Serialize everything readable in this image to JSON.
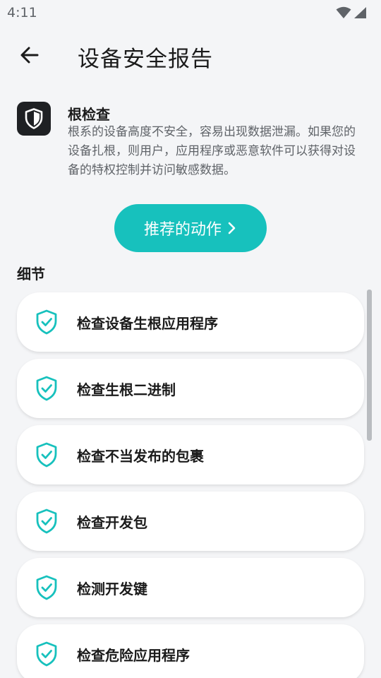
{
  "status_bar": {
    "time": "4:11",
    "icons": [
      "wifi-icon",
      "signal-icon"
    ]
  },
  "toolbar": {
    "back_icon": "arrow-left-icon",
    "title": "设备安全报告"
  },
  "root_check": {
    "icon": "shield-icon",
    "title": "根检查",
    "description": "根系的设备高度不安全，容易出现数据泄漏。如果您的设备扎根，则用户，应用程序或恶意软件可以获得对设备的特权控制并访问敏感数据。"
  },
  "action_button": {
    "label": "推荐的动作",
    "icon": "chevron-right-icon"
  },
  "details": {
    "label": "细节",
    "items": [
      {
        "label": "检查设备生根应用程序",
        "icon": "shield-check-icon"
      },
      {
        "label": "检查生根二进制",
        "icon": "shield-check-icon"
      },
      {
        "label": "检查不当发布的包裹",
        "icon": "shield-check-icon"
      },
      {
        "label": "检查开发包",
        "icon": "shield-check-icon"
      },
      {
        "label": "检测开发键",
        "icon": "shield-check-icon"
      },
      {
        "label": "检查危险应用程序",
        "icon": "shield-check-icon"
      }
    ]
  },
  "colors": {
    "accent": "#17c1bd",
    "background": "#f4f5f7",
    "card": "#ffffff",
    "text_primary": "#1b1b1b",
    "text_secondary": "#5f6368"
  }
}
